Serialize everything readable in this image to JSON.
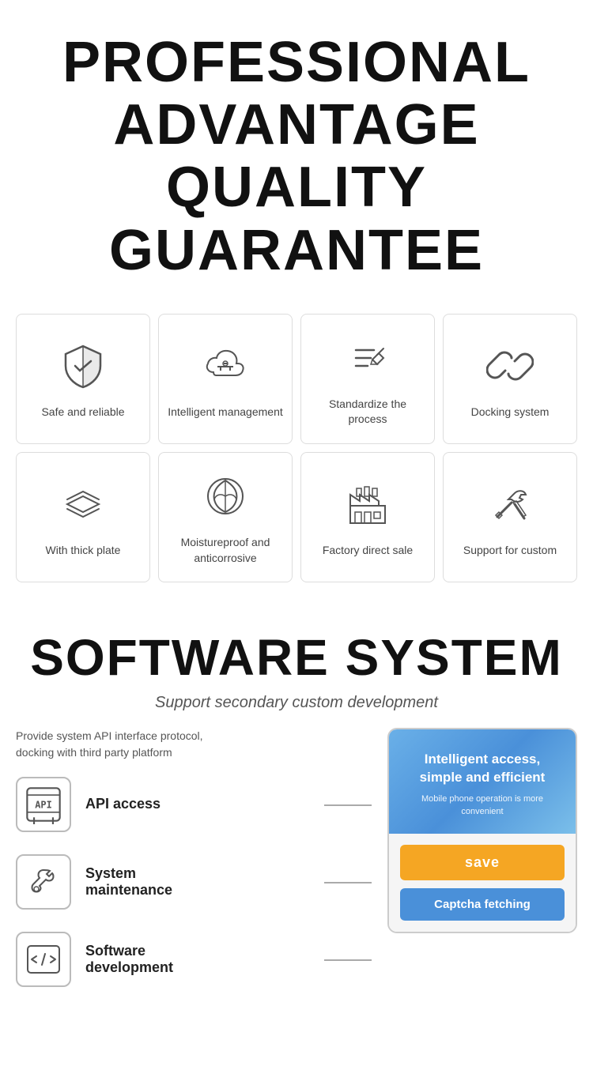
{
  "header": {
    "line1": "PROFESSIONAL",
    "line2": "ADVANTAGE",
    "line3": "QUALITY GUARANTEE"
  },
  "grid": {
    "row1": [
      {
        "id": "safe-reliable",
        "label": "Safe and reliable",
        "icon": "shield"
      },
      {
        "id": "intelligent-management",
        "label": "Intelligent management",
        "icon": "cloud-settings"
      },
      {
        "id": "standardize-process",
        "label": "Standardize the process",
        "icon": "edit-list"
      },
      {
        "id": "docking-system",
        "label": "Docking system",
        "icon": "link"
      }
    ],
    "row2": [
      {
        "id": "thick-plate",
        "label": "With thick plate",
        "icon": "layers"
      },
      {
        "id": "moistureproof",
        "label": "Moistureproof and anticorrosive",
        "icon": "leaf"
      },
      {
        "id": "factory-direct",
        "label": "Factory direct sale",
        "icon": "factory"
      },
      {
        "id": "support-custom",
        "label": "Support for custom",
        "icon": "tools"
      }
    ]
  },
  "software": {
    "title": "SOFTWARE SYSTEM",
    "subtitle": "Support secondary custom development",
    "description": "Provide system API interface protocol,\ndocking with third party platform",
    "features": [
      {
        "id": "api-access",
        "label": "API access",
        "icon": "api"
      },
      {
        "id": "system-maintenance",
        "label": "System\nmaintenance",
        "icon": "wrench"
      },
      {
        "id": "software-development",
        "label": "Software\ndevelopment",
        "icon": "code"
      }
    ],
    "panel": {
      "main_text": "Intelligent access,\nsimple and efficient",
      "sub_text": "Mobile phone operation is more convenient",
      "save_label": "save",
      "captcha_label": "Captcha fetching"
    }
  }
}
